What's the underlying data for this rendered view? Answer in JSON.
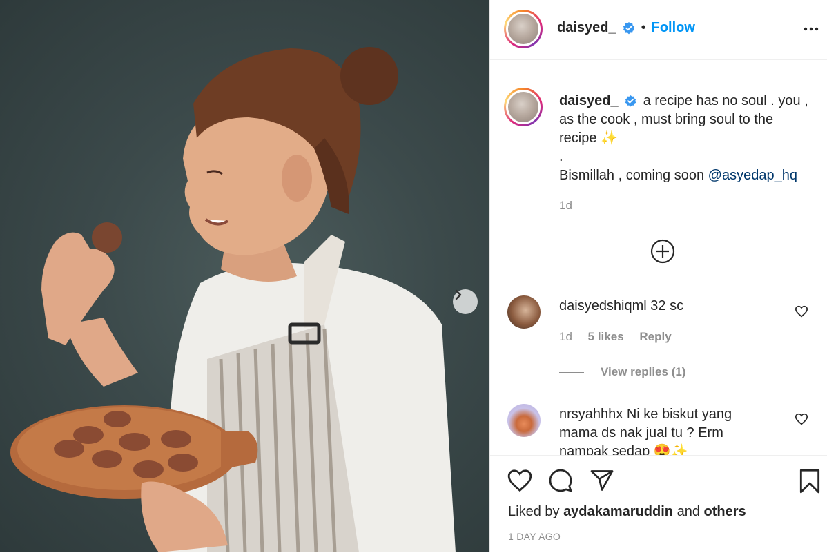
{
  "post": {
    "username": "daisyed_",
    "follow_label": "Follow",
    "separator": "•",
    "caption_lines": [
      "a recipe has no soul . you ,",
      "as the cook , must bring soul to the",
      "recipe ✨",
      ".",
      "Bismillah , coming soon "
    ],
    "caption_mention": "@asyedap_hq",
    "caption_time": "1d"
  },
  "comments": [
    {
      "username": "daisyedshiqml",
      "text": " 32 sc",
      "time": "1d",
      "likes": "5 likes",
      "reply": "Reply",
      "view_replies": "View replies (1)"
    },
    {
      "username": "nrsyahhhx",
      "text_lines": [
        " Ni ke biskut yang",
        "mama ds nak jual tu ? Erm",
        "nampak sedap 😍✨"
      ]
    }
  ],
  "footer": {
    "liked_prefix": "Liked by ",
    "liked_user": "aydakamaruddin",
    "liked_and": " and ",
    "liked_others": "others",
    "timestamp": "1 DAY AGO"
  },
  "colors": {
    "accent": "#0095f6",
    "mention": "#00376b",
    "muted": "#8e8e8e",
    "text": "#262626"
  },
  "icons": [
    "verified-badge-icon",
    "more-options-icon",
    "add-circle-icon",
    "heart-icon",
    "comment-icon",
    "share-icon",
    "bookmark-icon",
    "chevron-right-icon"
  ]
}
